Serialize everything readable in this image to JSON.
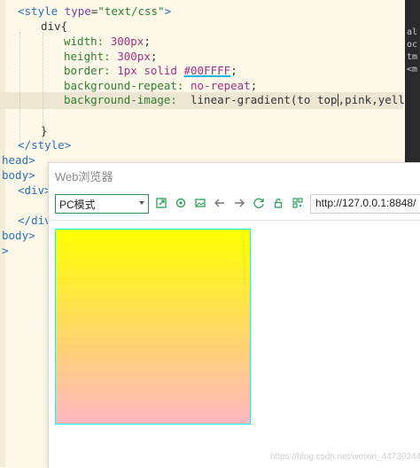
{
  "editor": {
    "lines": {
      "l0_open": "<",
      "l0_tag": "style",
      "l0_attr": "type",
      "l0_eq": "=",
      "l0_str": "\"text/css\"",
      "l0_close": ">",
      "l1": "div{",
      "l2_prop": "width:",
      "l2_val": "300px",
      "l2_end": ";",
      "l3_prop": "height:",
      "l3_val": "300px",
      "l3_end": ";",
      "l4_prop": "border:",
      "l4_v1": "1px",
      "l4_v2": "solid",
      "l4_v3": "#00FFFF",
      "l4_end": ";",
      "l5_prop": "background-repeat:",
      "l5_val": "no-repeat",
      "l5_end": ";",
      "l6_prop": "background-image:",
      "l6_fn_a": "  linear-gradient(to top",
      "l6_fn_b": ",pink,yellow);",
      "l8": "}",
      "l9_a": "</",
      "l9_tag": "style",
      "l9_b": ">",
      "l10": "head>",
      "l11": "body>",
      "l12_a": "<",
      "l12_tag": "div",
      "l12_b": ">",
      "l13_a": "</",
      "l13_tag": "div",
      "l13_b": ">",
      "l14": "body>",
      "l15": ">"
    },
    "right_panel": [
      "al",
      "oc",
      "tm",
      "<m"
    ]
  },
  "browser": {
    "title": "Web浏览器",
    "mode_value": "PC模式",
    "url": "http://127.0.0.1:8848/",
    "icons": [
      "open-external-icon",
      "settings-icon",
      "screenshot-icon",
      "back-arrow-icon",
      "forward-arrow-icon",
      "refresh-icon",
      "lock-icon",
      "qr-code-icon"
    ],
    "rendered_div": {
      "width": 300,
      "height": 300,
      "border_color": "#00FFFF",
      "gradient_direction": "to top",
      "gradient_colors": [
        "pink",
        "yellow"
      ]
    }
  },
  "watermark": "https://blog.csdn.net/weixin_44730244"
}
